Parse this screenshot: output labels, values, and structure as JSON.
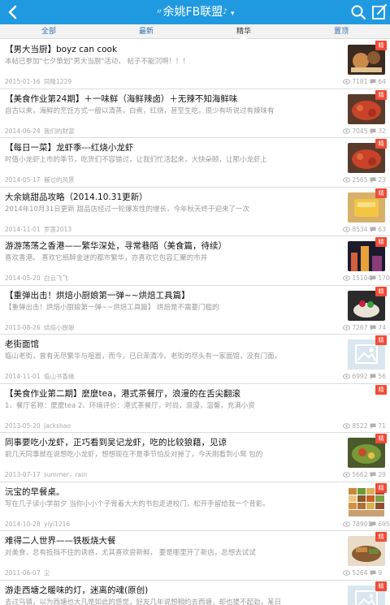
{
  "header": {
    "title": "余姚FB联盟",
    "deco_left": "〃",
    "deco_right": "♪",
    "caret": "▾"
  },
  "tabs": [
    {
      "label": "全部"
    },
    {
      "label": "最新"
    },
    {
      "label": "精华"
    },
    {
      "label": "置顶"
    }
  ],
  "posts": [
    {
      "title": "【男大当厨】boyz can cook",
      "summary": "本帖已参加\"七夕策划\"男大当厨\"活动，   帖子不能沉啊！！！",
      "date": "2015-01-16",
      "author": "同隆1229",
      "views": "7181",
      "replies": "64",
      "badge": "精",
      "thumb": "food-dark"
    },
    {
      "title": "【美食作业第24期】＋一味鲜（海鲜辣卤）＋无辣不知海鲜味",
      "summary": "自古以来，海鲜的烹饪方式一般以清蒸，白煮，红烧，甚至生吃。很少有听说过有辣味有",
      "date": "2014-06-24",
      "author": "我们的财富",
      "views": "7045",
      "replies": "32",
      "badge": "精",
      "thumb": "food-red"
    },
    {
      "title": "【每日一菜】龙虾季---红烧小龙虾",
      "summary": "时值小龙虾上市的季节，吃货们不容错过，让我们忙活起来，大快朵颐，让那小龙虾上",
      "date": "2014-05-17",
      "author": "搬过的风景",
      "views": "2565",
      "replies": "23",
      "badge": "精",
      "thumb": "food-red"
    },
    {
      "title": "大余姚甜品攻略（2014.10.31更新）",
      "summary": "2014年10月31日更新  甜品店经过一轮爆发性的增长，今年秋天终于迎来了一次",
      "date": "2014-11-01",
      "author": "罗莲2013",
      "views": "8534",
      "replies": "63",
      "badge": "精",
      "thumb": "food-yellow"
    },
    {
      "title": "游游荡荡之香港——繁华深处，寻常巷陌（美食篇，待续）",
      "summary": "喜欢香港。        喜欢它纸醉金迷的都市繁华，亦喜欢它包容汇聚的市井",
      "date": "2014-05-20",
      "author": "白云飞飞",
      "views": "15104",
      "replies": "170",
      "badge": "精",
      "thumb": "city"
    },
    {
      "title": "【重弹出击！烘焙小厨娘第一弹~~烘焙工具篇】",
      "summary": "【重弹出击！烘焙小厨娘第一弹~~烘焙工具篇】      烘焙是不需要门槛的",
      "date": "2013-08-26",
      "author": "烘焙小厨娘",
      "views": "7267",
      "replies": "74",
      "badge": "精",
      "thumb": "cake"
    },
    {
      "title": "老街面馆",
      "summary": "临山老街，曾有无尽繁华与喧嚣，而今，已日渐清冷。老街的尽头有一家面馆，没有门面，",
      "date": "2014-11-01",
      "author": "临山书香缘",
      "views": "6992",
      "replies": "56",
      "badge": "精",
      "thumb": "placeholder"
    },
    {
      "title": "【美食作业第二期】麼麼tea，港式茶餐厅，浪漫的在舌尖翻滚",
      "summary": "1、餐厅名称：麼麼tea 2、环境评价：港式茶餐厅，时尚，浪漫，温馨，充满小资",
      "date": "2013-05-20",
      "author": "jackshao",
      "views": "8522",
      "replies": "71",
      "badge": "精",
      "thumb": "none"
    },
    {
      "title": "同事要吃小龙虾，正巧看到吴记龙虾，吃的比较狼藉，见谅",
      "summary": "前几天同事就在说想吃小龙虾，想想现在不是季节怕反对掉了，今天刚看到小鸳  包的",
      "date": "2013-07-17",
      "author": "summer，rain",
      "views": "5662",
      "replies": "29",
      "badge": "精",
      "thumb": "food-green"
    },
    {
      "title": "沅宝的早餐桌。",
      "summary": "写在几子读小学前夕  当你小小个子背着大大的书包走进校门，松开手留给我一个背影。",
      "date": "2014-10-28",
      "author": "yiyi1216",
      "views": "78901",
      "replies": "695",
      "badge": "精",
      "thumb": "grid"
    },
    {
      "title": "难得二人世界——铁板烧大餐",
      "summary": "对美食，总有抵挡不住的诱惑，尤其喜欢尝新鲜，  要是哪里开了新店，总想去试试",
      "date": "2011-06-07",
      "author": "尘",
      "views": "5264",
      "replies": "9",
      "badge": "精",
      "thumb": "food-brown"
    },
    {
      "title": "游走西塘之暖味的灯，迷离的魂(原创)",
      "summary": "去过乌镇，以为西塘也大凡是如此的感觉，好友几年说想相约去西塘，却也提不起劲，某日",
      "date": "",
      "author": "",
      "views": "",
      "replies": "",
      "badge": "精",
      "thumb": "placeholder"
    }
  ],
  "icons": {
    "back": "chevron-left-icon",
    "search": "search-icon",
    "edit": "edit-icon",
    "views": "eye-icon",
    "replies": "comment-icon"
  },
  "colors": {
    "header": "#1f9ae0",
    "badge": "#f04c37",
    "tab_text": "#3a6fb0"
  }
}
